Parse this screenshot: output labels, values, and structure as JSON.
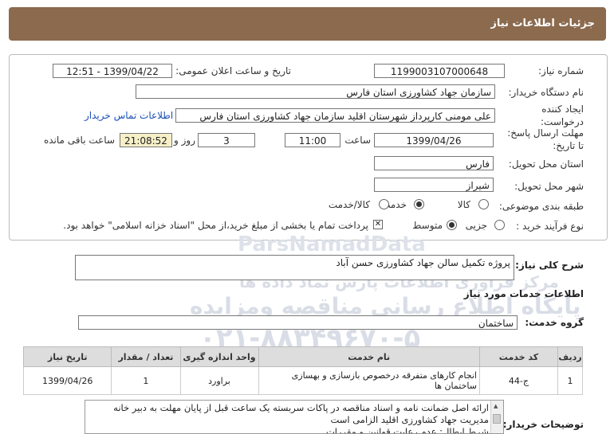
{
  "header": {
    "title": "جزئیات اطلاعات نیاز"
  },
  "labels": {
    "need_number": "شماره نیاز:",
    "announce_datetime": "تاریخ و ساعت اعلان عمومی:",
    "buyer_org": "نام دستگاه خریدار:",
    "creator_line1": "ایجاد کننده",
    "creator_line2": "درخواست:",
    "deadline_line1": "مهلت ارسال پاسخ:",
    "deadline_line2": "تا تاریخ:",
    "time_word": "ساعت",
    "day_word": "روز و",
    "remaining_word": "ساعت باقی مانده",
    "delivery_province": "استان محل تحویل:",
    "delivery_city": "شهر محل تحویل:",
    "category": "طبقه بندی موضوعی:",
    "purchase_process": "نوع فرآیند خرید :",
    "general_desc": "شرح کلی نیاز:",
    "services_info": "اطلاعات خدمات مورد نیاز",
    "service_group": "گروه خدمت:",
    "buyer_notes": "توضیحات خریدار:"
  },
  "values": {
    "need_number": "1199003107000648",
    "announce_datetime": "1399/04/22 - 12:51",
    "buyer_org": "سازمان جهاد کشاورزی استان فارس",
    "creator": "علی  مومنی  کارپرداز شهرستان اقلید  سازمان جهاد کشاورزی استان فارس",
    "contact_link": "اطلاعات تماس خریدار",
    "deadline_date": "1399/04/26",
    "deadline_time": "11:00",
    "days": "3",
    "remaining_time": "21:08:52",
    "province": "فارس",
    "city": "شیراز",
    "general_desc": "پروژه تکمیل سالن جهاد کشاورزی حسن آباد",
    "service_group": "ساختمان"
  },
  "category_options": [
    {
      "label": "کالا",
      "selected": false
    },
    {
      "label": "خدمت",
      "selected": true
    },
    {
      "label": "کالا/خدمت",
      "selected": false
    }
  ],
  "process_options": [
    {
      "label": "جزیی",
      "selected": false
    },
    {
      "label": "متوسط",
      "selected": true
    }
  ],
  "payment_note": "پرداخت تمام یا بخشی از مبلغ خرید،از محل \"اسناد خزانه اسلامی\" خواهد بود.",
  "payment_checked": true,
  "table": {
    "headers": [
      "ردیف",
      "کد خدمت",
      "نام خدمت",
      "واحد اندازه گیری",
      "تعداد / مقدار",
      "تاریخ نیاز"
    ],
    "rows": [
      [
        "1",
        "ج-44",
        "انجام کارهای متفرقه درخصوص بازسازی و بهسازی ساختمان ها",
        "براورد",
        "1",
        "1399/04/26"
      ]
    ]
  },
  "notes_lines": [
    "ارائه اصل ضمانت نامه و اسناد مناقصه  در پاکات سربسته یک ساعت قبل از پایان مهلت به دبیر خانه",
    "مدیریت جهاد کشاورزی اقلید الزامی است",
    "شرط ابطال: عدم رعایت قوانین و مقررات"
  ],
  "watermark": {
    "brand": "ParsNamadData",
    "line1": "مرکز فراوری اطلاعات پارس نماد داده ها",
    "line2": "پایگاه اطلاع رسانی مناقصه ومزایده",
    "phone": "۰۲۱-۸۸۳۴۹۶۷۰-۵"
  }
}
